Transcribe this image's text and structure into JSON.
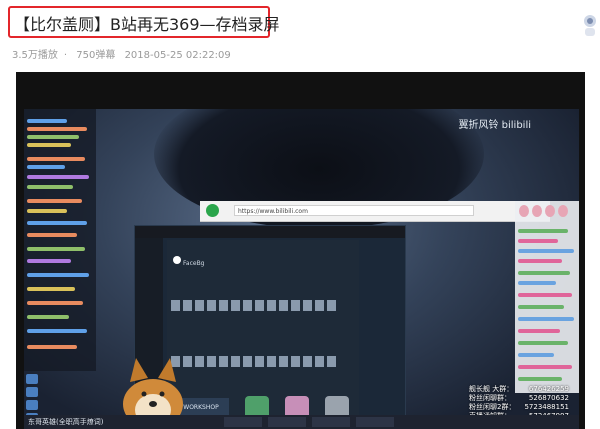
{
  "video": {
    "title": "【比尔盖厕】B站再无369—存档录屏",
    "plays": "3.5万播放",
    "danmaku": "750弹幕",
    "date": "2018-05-25 02:22:09"
  },
  "player": {
    "watermark": "翼折风铃 bilibili",
    "browser_url": "https://www.bilibili.com",
    "steam_profile_name": "FaceBg",
    "workshop_label": "WORKSHOP",
    "taskbar_text": "东哥英雄(全职高手燎词)",
    "stats": [
      {
        "label": "舰长舰 大群：",
        "value": "676426259"
      },
      {
        "label": "粉丝闲聊群：",
        "value": "526870632"
      },
      {
        "label": "粉丝闲聊2群：",
        "value": "5723488151"
      },
      {
        "label": "直播通知群：",
        "value": "572467997"
      }
    ]
  }
}
